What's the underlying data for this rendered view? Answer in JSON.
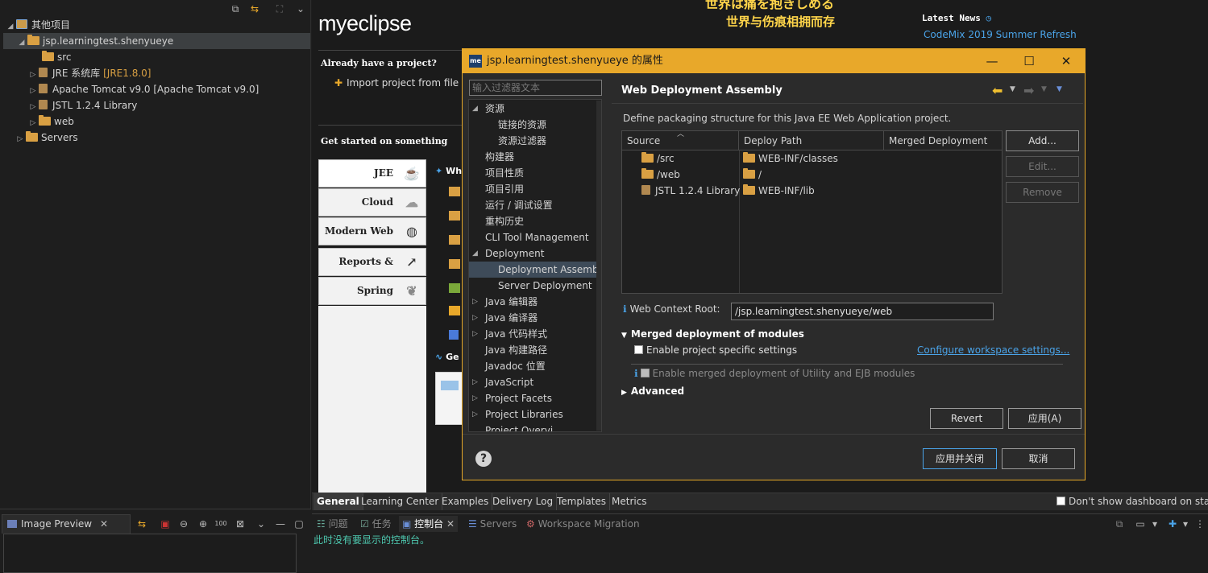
{
  "explorer": {
    "tree": [
      {
        "label": "其他项目",
        "depth": 0,
        "expanded": true
      },
      {
        "label": "jsp.learningtest.shenyueye",
        "depth": 1,
        "expanded": true,
        "selected": true
      },
      {
        "label": "src",
        "depth": 2
      },
      {
        "label": "JRE 系统库",
        "suffix": "[JRE1.8.0]",
        "depth": 2
      },
      {
        "label": "Apache Tomcat v9.0 [Apache Tomcat v9.0]",
        "depth": 2
      },
      {
        "label": "JSTL 1.2.4 Library",
        "depth": 2
      },
      {
        "label": "web",
        "depth": 2
      },
      {
        "label": "Servers",
        "depth": 1
      }
    ]
  },
  "image_preview": {
    "tab_label": "Image Preview"
  },
  "dashboard": {
    "logo": "myeclipse",
    "banner_line1": "世界は痛を抱きしめる",
    "banner_line2": "世界与伤痕相拥而存",
    "latest_news": "Latest News",
    "codemix_link": "CodeMix 2019 Summer Refresh",
    "already_have": "Already have a project?",
    "import_project": "Import project from file sy",
    "get_started": "Get started on something",
    "categories": [
      "JEE",
      "Cloud",
      "Modern Web",
      "Reports & DB",
      "Spring"
    ],
    "panel_heading_partial": "Wh",
    "panel_heading2_partial": "Ge",
    "bottom_tabs": [
      "General",
      "Learning Center",
      "Examples",
      "Delivery Log",
      "Templates",
      "Metrics"
    ],
    "dont_show": "Don't show dashboard on sta"
  },
  "console": {
    "tabs": [
      "问题",
      "任务",
      "控制台",
      "Servers",
      "Workspace Migration"
    ],
    "active_tab": "控制台",
    "message": "此时没有要显示的控制台。"
  },
  "dialog": {
    "title": "jsp.learningtest.shenyueye 的属性",
    "filter_placeholder": "输入过滤器文本",
    "nav": [
      {
        "label": "资源",
        "depth": 0,
        "twisty": "open"
      },
      {
        "label": "链接的资源",
        "depth": 1
      },
      {
        "label": "资源过滤器",
        "depth": 1
      },
      {
        "label": "构建器",
        "depth": 0
      },
      {
        "label": "项目性质",
        "depth": 0
      },
      {
        "label": "项目引用",
        "depth": 0
      },
      {
        "label": "运行 / 调试设置",
        "depth": 0
      },
      {
        "label": "重构历史",
        "depth": 0
      },
      {
        "label": "CLI Tool Management",
        "depth": 0
      },
      {
        "label": "Deployment",
        "depth": 0,
        "twisty": "open"
      },
      {
        "label": "Deployment Assembl",
        "depth": 1,
        "selected": true
      },
      {
        "label": "Server Deployment",
        "depth": 1
      },
      {
        "label": "Java 编辑器",
        "depth": 0,
        "twisty": "closed"
      },
      {
        "label": "Java 编译器",
        "depth": 0,
        "twisty": "closed"
      },
      {
        "label": "Java 代码样式",
        "depth": 0,
        "twisty": "closed"
      },
      {
        "label": "Java 构建路径",
        "depth": 0
      },
      {
        "label": "Javadoc 位置",
        "depth": 0
      },
      {
        "label": "JavaScript",
        "depth": 0,
        "twisty": "closed"
      },
      {
        "label": "Project Facets",
        "depth": 0,
        "twisty": "closed"
      },
      {
        "label": "Project Libraries",
        "depth": 0,
        "twisty": "closed"
      },
      {
        "label": "Project Overvi",
        "depth": 0
      }
    ],
    "page_title": "Web Deployment Assembly",
    "description": "Define packaging structure for this Java EE Web Application project.",
    "columns": [
      "Source",
      "Deploy Path",
      "Merged Deployment"
    ],
    "rows": [
      {
        "source": "/src",
        "deploy": "WEB-INF/classes",
        "icon": "folder"
      },
      {
        "source": "/web",
        "deploy": "/",
        "icon": "folder"
      },
      {
        "source": "JSTL 1.2.4 Library",
        "deploy": "WEB-INF/lib",
        "icon": "library"
      }
    ],
    "side_buttons": {
      "add": "Add...",
      "edit": "Edit...",
      "remove": "Remove"
    },
    "context_root_label": "Web Context Root:",
    "context_root_value": "/jsp.learningtest.shenyueye/web",
    "merged_section": "Merged deployment of modules",
    "enable_specific": "Enable project specific settings",
    "configure_link": "Configure workspace settings...",
    "enable_merged": "Enable merged deployment of Utility and EJB modules",
    "advanced": "Advanced",
    "revert": "Revert",
    "apply": "应用(A)",
    "apply_close": "应用并关闭",
    "cancel": "取消"
  },
  "colors": {
    "accent": "#e8a82a",
    "link": "#4aa3e8",
    "folder": "#d9a043"
  }
}
